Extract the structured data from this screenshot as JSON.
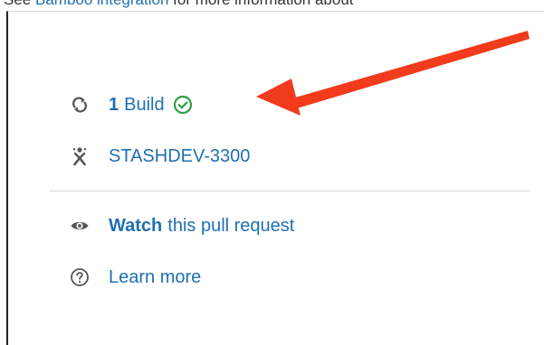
{
  "top_text": {
    "prefix": "See ",
    "link": "Bamboo integration",
    "suffix": " for more information about"
  },
  "builds": {
    "count": "1",
    "label": "Build",
    "status_icon": "check-circle-icon",
    "status_color": "#2e9e45"
  },
  "jira_issue": {
    "key": "STASHDEV-3300",
    "icon": "jira-icon"
  },
  "watch": {
    "action": "Watch",
    "rest": "this pull request",
    "icon": "eye-icon"
  },
  "learn_more": {
    "label": "Learn more",
    "icon": "help-circle-icon"
  },
  "annotation": {
    "arrow_color": "#f23a1c"
  },
  "colors": {
    "link": "#1f6fb2",
    "icon": "#555555"
  }
}
